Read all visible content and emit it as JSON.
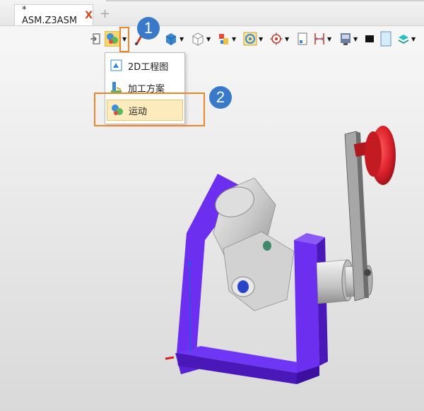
{
  "tabs": [
    {
      "label": "* ASM.Z3ASM",
      "close": "X"
    }
  ],
  "tab_add": "+",
  "toolbar": {
    "icons": [
      "exit-icon",
      "analysis-icon",
      "sketch-icon",
      "solid-view-icon",
      "wireframe-view-icon",
      "assembly-icon",
      "render-icon",
      "target-icon",
      "document-icon",
      "dimension-icon",
      "display-icon",
      "color-icon",
      "transparency-icon",
      "layer-icon"
    ]
  },
  "menu": {
    "items": [
      {
        "label": "2D工程图",
        "icon": "drawing-icon"
      },
      {
        "label": "加工方案",
        "icon": "machining-icon"
      },
      {
        "label": "运动",
        "icon": "motion-icon",
        "selected": true
      }
    ]
  },
  "annotations": {
    "step1": "1",
    "step2": "2"
  },
  "colors": {
    "highlight": "#f0862a",
    "badge": "#3979c9",
    "frame": "#6c2ff0",
    "knob": "#d8202a"
  }
}
